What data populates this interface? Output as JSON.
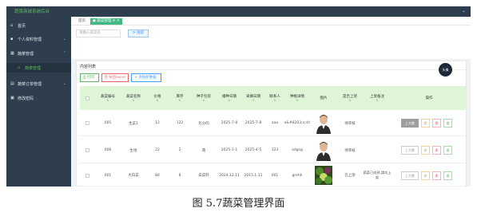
{
  "app": {
    "title": "蔬菜商城系统后台"
  },
  "sidebar": {
    "items": [
      {
        "label": "首页",
        "icon": "home-icon",
        "has_children": false
      },
      {
        "label": "个人资料管理",
        "icon": "user-icon",
        "has_children": true
      },
      {
        "label": "蔬菜管理",
        "icon": "grid-icon",
        "has_children": true
      },
      {
        "label": "蔬菜管理",
        "icon": "leaf-icon",
        "has_children": false,
        "sub": true
      },
      {
        "label": "蔬菜订单管理",
        "icon": "order-icon",
        "has_children": true
      },
      {
        "label": "修改密码",
        "icon": "lock-icon",
        "has_children": false
      }
    ]
  },
  "tabs": [
    {
      "label": "首页",
      "active": false
    },
    {
      "label": "● 蔬菜管理 ⟳ ✕",
      "active": true
    }
  ],
  "search": {
    "placeholder": "请输入蔬菜名",
    "button_label": "⟳ 搜索"
  },
  "panel": {
    "title": "内容列表"
  },
  "toolbar": {
    "print_label": "⎙ 打印",
    "export_label": "⎘ 导出excel",
    "add_label": "+ 添加新数据"
  },
  "user": {
    "avatar_label": "头像"
  },
  "table": {
    "columns": [
      "蔬菜编号",
      "蔬菜名称",
      "价格",
      "库存",
      "种子包装",
      "播种日期",
      "采摘日期",
      "联系人",
      "种植详情",
      "图片",
      "是否上架",
      "上架备注",
      "操作"
    ],
    "rows": [
      {
        "id": "005",
        "name": "生菜1",
        "price": "12",
        "stock": "122",
        "pack": "包分的",
        "sow": "2025-7-8",
        "pick": "2025-7-8",
        "contact": "aaa",
        "detail": "a&#8203;s;sfr",
        "image": "person",
        "listed": "待审核",
        "note": "",
        "up_label": "上大数",
        "up_filled": true
      },
      {
        "id": "006",
        "name": "生地",
        "price": "22",
        "stock": "2",
        "pack": "萌",
        "sow": "2025-1-1",
        "pick": "2025-4-5",
        "contact": "123",
        "detail": "adgsg",
        "image": "person",
        "listed": "待审核",
        "note": "",
        "up_label": "上大数",
        "up_filled": false
      },
      {
        "id": "001",
        "name": "大白菜",
        "price": "84",
        "stock": "8",
        "pack": "白菜籽",
        "sow": "2024.12.11",
        "pick": "2015.1.11",
        "contact": "001",
        "detail": "grehh",
        "image": "vegetable",
        "listed": "已上架",
        "note": "蔬菜已成熟,請勿上架",
        "up_label": "上大数",
        "up_filled": false
      }
    ],
    "op_labels": {
      "a": "修",
      "b": "删",
      "c": "查"
    }
  },
  "caption": "图 5.7蔬菜管理界面"
}
